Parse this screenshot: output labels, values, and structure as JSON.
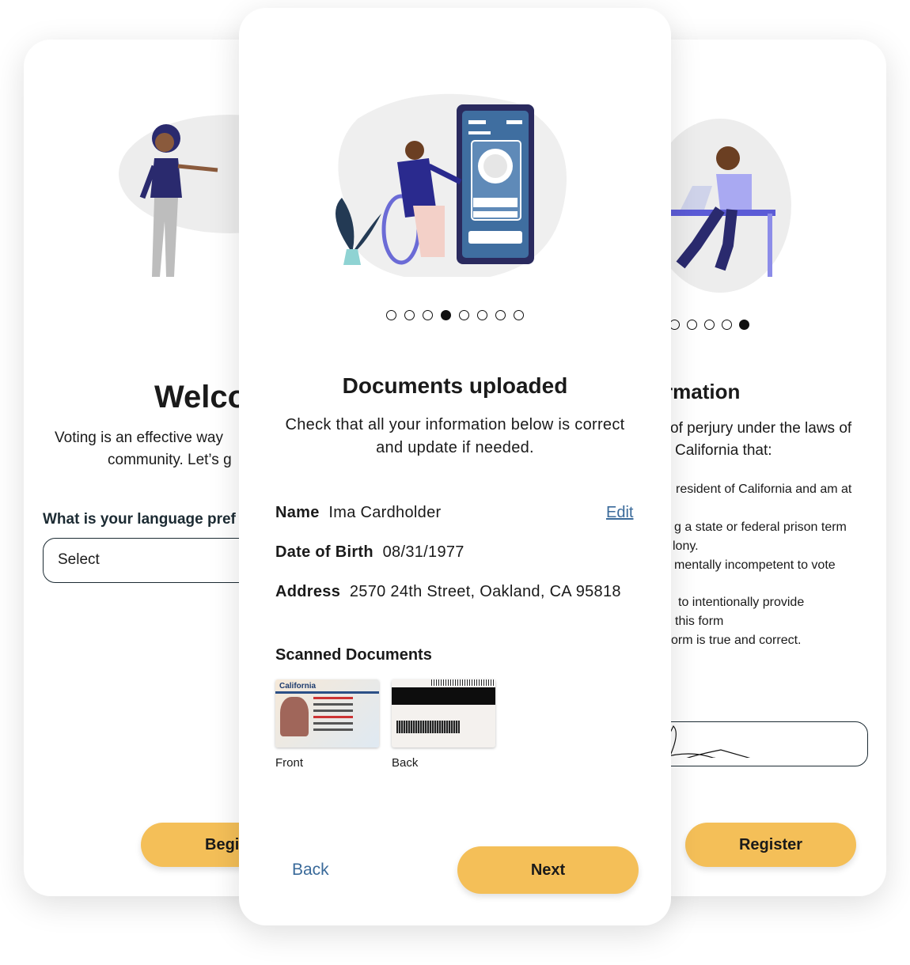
{
  "left_card": {
    "title": "Welco",
    "body_line1": "Voting is an effective way",
    "body_line2": "community. Let’s g",
    "question": "What is your language pref",
    "select_value": "Select",
    "button": "Begi"
  },
  "center_card": {
    "carousel": {
      "total": 8,
      "active": 4
    },
    "title": "Documents uploaded",
    "subtitle_line1": "Check that all your information below is correct",
    "subtitle_line2": "and update if needed.",
    "fields": [
      {
        "label": "Name",
        "value": "Ima Cardholder"
      },
      {
        "label": "Date of Birth",
        "value": "08/31/1977"
      },
      {
        "label": "Address",
        "value": "2570 24th Street, Oakland, CA 95818"
      }
    ],
    "edit_link": "Edit",
    "scanned_title": "Scanned Documents",
    "front_label": "Front",
    "back_label": "Back",
    "id_front_state": "California",
    "back_button": "Back",
    "next_button": "Next"
  },
  "right_card": {
    "carousel_visible": 5,
    "active_index": 5,
    "title": "rmation",
    "lines": [
      "of perjury under the laws of",
      "California that:",
      "resident of California and am at",
      "g a state or federal prison term",
      "lony.",
      "mentally incompetent to vote",
      "to intentionally provide",
      "this form",
      "orm is true and correct."
    ],
    "button": "Register"
  },
  "colors": {
    "accent": "#f4bf58",
    "link": "#3a6a9a",
    "navy": "#2a2a6e"
  }
}
